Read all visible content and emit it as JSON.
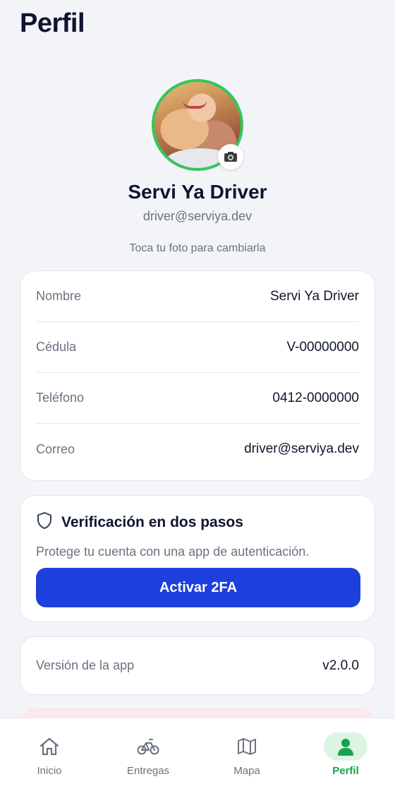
{
  "header": {
    "title": "Perfil"
  },
  "profile": {
    "name": "Servi Ya Driver",
    "email": "driver@serviya.dev",
    "photo_hint": "Toca tu foto para cambiarla",
    "avatar_ring_color": "#34c759",
    "camera_icon": "camera-icon"
  },
  "info": {
    "rows": [
      {
        "label": "Nombre",
        "value": "Servi Ya Driver"
      },
      {
        "label": "Cédula",
        "value": "V-00000000"
      },
      {
        "label": "Teléfono",
        "value": "0412-0000000"
      },
      {
        "label": "Correo",
        "value": "driver@serviya.dev"
      }
    ]
  },
  "twofa": {
    "icon": "shield-icon",
    "title": "Verificación en dos pasos",
    "description": "Protege tu cuenta con una app de autenticación.",
    "button_label": "Activar 2FA",
    "button_color": "#1d3fdc"
  },
  "version": {
    "label": "Versión de la app",
    "value": "v2.0.0"
  },
  "nav": {
    "items": [
      {
        "label": "Inicio",
        "icon": "home-icon"
      },
      {
        "label": "Entregas",
        "icon": "bike-icon"
      },
      {
        "label": "Mapa",
        "icon": "map-icon"
      },
      {
        "label": "Perfil",
        "icon": "user-icon",
        "active": true
      }
    ],
    "active_color": "#16a34a"
  }
}
